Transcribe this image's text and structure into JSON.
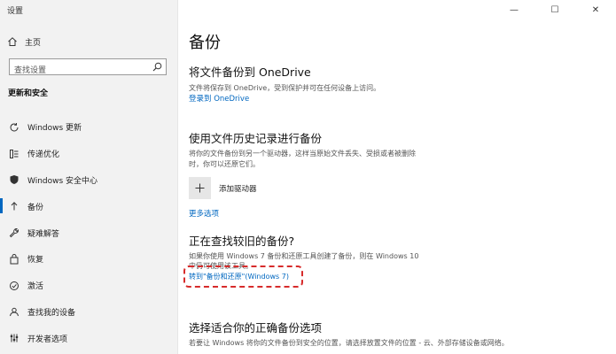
{
  "window": {
    "title": "设置",
    "controls": {
      "minimize": "—",
      "maximize": "☐",
      "close": "✕"
    }
  },
  "sidebar": {
    "home_label": "主页",
    "search": {
      "placeholder": "查找设置",
      "value": ""
    },
    "section_title": "更新和安全",
    "items": [
      {
        "label": "Windows 更新",
        "icon": "sync-icon",
        "active": false
      },
      {
        "label": "传递优化",
        "icon": "delivery-optimization-icon",
        "active": false
      },
      {
        "label": "Windows 安全中心",
        "icon": "shield-icon",
        "active": false
      },
      {
        "label": "备份",
        "icon": "backup-arrow-icon",
        "active": true
      },
      {
        "label": "疑难解答",
        "icon": "wrench-icon",
        "active": false
      },
      {
        "label": "恢复",
        "icon": "recovery-icon",
        "active": false
      },
      {
        "label": "激活",
        "icon": "activation-icon",
        "active": false
      },
      {
        "label": "查找我的设备",
        "icon": "find-device-icon",
        "active": false
      },
      {
        "label": "开发者选项",
        "icon": "developer-icon",
        "active": false
      }
    ]
  },
  "main": {
    "title": "备份",
    "onedrive": {
      "heading": "将文件备份到 OneDrive",
      "desc": "文件将保存到 OneDrive，受到保护并可在任何设备上访问。",
      "link": "登录到 OneDrive"
    },
    "file_history": {
      "heading": "使用文件历史记录进行备份",
      "desc_line1": "将你的文件备份到另一个驱动器，这样当原始文件丢失、受损或者被删除",
      "desc_line2": "时，你可以还原它们。",
      "add_drive_label": "添加驱动器",
      "more_options": "更多选项"
    },
    "older_backup": {
      "heading": "正在查找较旧的备份?",
      "desc_line1": "如果你使用 Windows 7 备份和还原工具创建了备份，则在 Windows 10",
      "desc_line2": "中仍可使用该工具。",
      "link": "转到\"备份和还原\"(Windows 7)"
    },
    "choose_backup": {
      "heading": "选择适合你的正确备份选项",
      "desc": "若要让 Windows 将你的文件备份到安全的位置，请选择放置文件的位置 - 云、外部存储设备或网络。"
    }
  }
}
